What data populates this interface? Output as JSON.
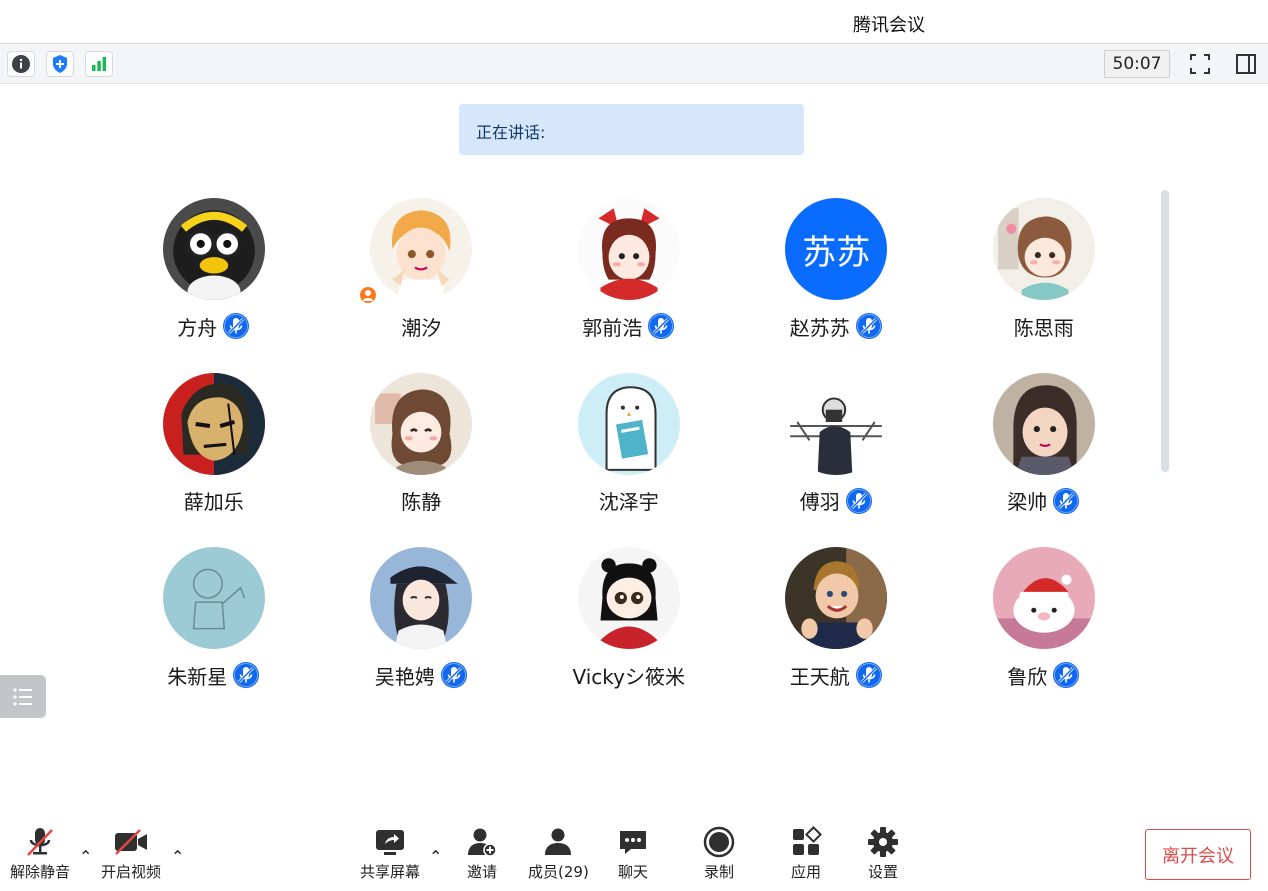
{
  "window": {
    "title": "腾讯会议"
  },
  "toolbar": {
    "timer": "50:07",
    "icons": [
      "info-icon",
      "shield-icon",
      "signal-icon",
      "fullscreen-icon",
      "sidebar-toggle-icon"
    ]
  },
  "speaking": {
    "label": "正在讲话:"
  },
  "participants": [
    {
      "name": "方舟",
      "muted_icon": true,
      "avatar": "penguin-avatar"
    },
    {
      "name": "潮汐",
      "muted_icon": false,
      "avatar": "anime-boy-avatar",
      "host_badge": true
    },
    {
      "name": "郭前浩",
      "muted_icon": true,
      "avatar": "chibi-girl-red-avatar"
    },
    {
      "name": "赵苏苏",
      "muted_icon": true,
      "avatar": "text-avatar",
      "avatar_text": "苏苏",
      "avatar_color": "#0a6cff"
    },
    {
      "name": "陈思雨",
      "muted_icon": false,
      "avatar": "chibi-girl-avatar"
    },
    {
      "name": "薛加乐",
      "muted_icon": false,
      "avatar": "anime-swordsman-avatar"
    },
    {
      "name": "陈静",
      "muted_icon": false,
      "avatar": "chibi-girl-brown-avatar"
    },
    {
      "name": "沈泽宇",
      "muted_icon": false,
      "avatar": "ghost-book-avatar"
    },
    {
      "name": "傅羽",
      "muted_icon": true,
      "avatar": "photographer-avatar"
    },
    {
      "name": "梁帅",
      "muted_icon": true,
      "avatar": "baby-photo-avatar"
    },
    {
      "name": "朱新星",
      "muted_icon": true,
      "avatar": "sketch-avatar"
    },
    {
      "name": "吴艳娉",
      "muted_icon": true,
      "avatar": "girl-cap-avatar"
    },
    {
      "name": "Vickyシ筱米",
      "muted_icon": false,
      "avatar": "girl-fan-avatar"
    },
    {
      "name": "王天航",
      "muted_icon": true,
      "avatar": "kid-thumbs-avatar"
    },
    {
      "name": "鲁欣",
      "muted_icon": true,
      "avatar": "pig-santa-avatar"
    }
  ],
  "bottom": {
    "unmute": "解除静音",
    "start_video": "开启视频",
    "share_screen": "共享屏幕",
    "invite": "邀请",
    "members": "成员(29)",
    "chat": "聊天",
    "record": "录制",
    "apps": "应用",
    "settings": "设置",
    "leave": "离开会议"
  },
  "colors": {
    "accent": "#0a6cff",
    "leave": "#e04a4a",
    "speaking_bg": "#d6e7fb"
  }
}
